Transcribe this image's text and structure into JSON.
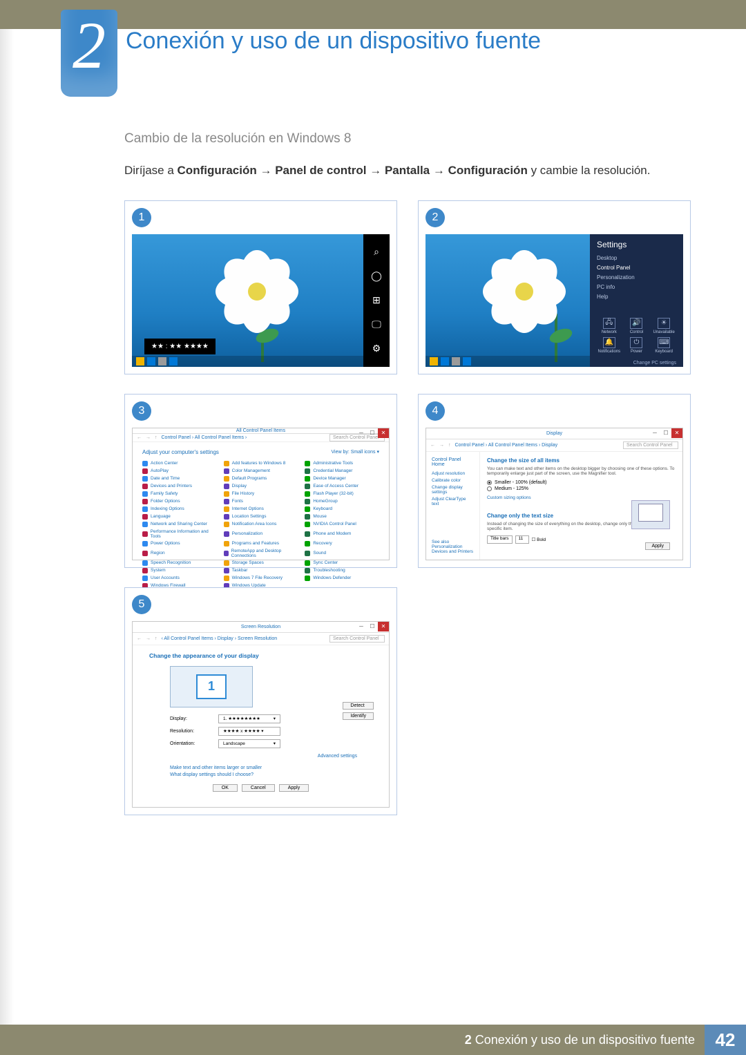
{
  "chapter": {
    "number": "2",
    "title": "Conexión y uso de un dispositivo fuente"
  },
  "section": {
    "subtitle": "Cambio de la resolución en Windows 8",
    "instruction_pre": "Diríjase a ",
    "path1": "Configuración",
    "path2": "Panel de control",
    "path3": "Pantalla",
    "path4": "Configuración",
    "instruction_post": " y cambie la resolución.",
    "arrow": "→"
  },
  "steps": [
    "1",
    "2",
    "3",
    "4",
    "5"
  ],
  "shot1": {
    "charms": {
      "search": "⌕",
      "share": "◯",
      "start": "⊞",
      "devices": "🖵",
      "settings": "⚙"
    },
    "clock": "★★ : ★★   ★★★★"
  },
  "shot2": {
    "settings_title": "Settings",
    "items": [
      "Desktop",
      "Control Panel",
      "Personalization",
      "PC info",
      "Help"
    ],
    "icons": [
      {
        "glyph": "🖧",
        "label": "Network"
      },
      {
        "glyph": "🔊",
        "label": "Control"
      },
      {
        "glyph": "☀",
        "label": "Unavailable"
      },
      {
        "glyph": "🔔",
        "label": "Notifications"
      },
      {
        "glyph": "⏻",
        "label": "Power"
      },
      {
        "glyph": "⌨",
        "label": "Keyboard"
      }
    ],
    "change": "Change PC settings"
  },
  "shot3": {
    "title": "All Control Panel Items",
    "crumb": "Control Panel  ›  All Control Panel Items  ›",
    "search_ph": "Search Control Panel",
    "heading": "Adjust your computer's settings",
    "viewby": "View by:   Small icons ▾",
    "links": [
      "Action Center",
      "Add features to Windows 8",
      "Administrative Tools",
      "AutoPlay",
      "Color Management",
      "Credential Manager",
      "Date and Time",
      "Default Programs",
      "Device Manager",
      "Devices and Printers",
      "Display",
      "Ease of Access Center",
      "Family Safety",
      "File History",
      "Flash Player (32-bit)",
      "Folder Options",
      "Fonts",
      "HomeGroup",
      "Indexing Options",
      "Internet Options",
      "Keyboard",
      "Language",
      "Location Settings",
      "Mouse",
      "Network and Sharing Center",
      "Notification Area Icons",
      "NVIDIA Control Panel",
      "Performance Information and Tools",
      "Personalization",
      "Phone and Modem",
      "Power Options",
      "Programs and Features",
      "Recovery",
      "Region",
      "RemoteApp and Desktop Connections",
      "Sound",
      "Speech Recognition",
      "Storage Spaces",
      "Sync Center",
      "System",
      "Taskbar",
      "Troubleshooting",
      "User Accounts",
      "Windows 7 File Recovery",
      "Windows Defender",
      "Windows Firewall",
      "Windows Update"
    ]
  },
  "shot4": {
    "title": "Display",
    "crumb": "Control Panel  ›  All Control Panel Items  ›  Display",
    "search_ph": "Search Control Panel",
    "side_head": "Control Panel Home",
    "side_links": [
      "Adjust resolution",
      "Calibrate color",
      "Change display settings",
      "Adjust ClearType text"
    ],
    "foot_head": "See also",
    "foot_links": [
      "Personalization",
      "Devices and Printers"
    ],
    "h1": "Change the size of all items",
    "desc": "You can make text and other items on the desktop bigger by choosing one of these options. To temporarily enlarge just part of the screen, use the Magnifier tool.",
    "r1": "Smaller - 100% (default)",
    "r2": "Medium - 125%",
    "custom": "Custom sizing options",
    "h2": "Change only the text size",
    "desc2": "Instead of changing the size of everything on the desktop, change only the text size for a specific item.",
    "dd1": "Title bars",
    "dd2": "11",
    "bold": "Bold",
    "apply": "Apply"
  },
  "shot5": {
    "title": "Screen Resolution",
    "crumb": "‹  All Control Panel Items  ›  Display  ›  Screen Resolution",
    "search_ph": "Search Control Panel",
    "h1": "Change the appearance of your display",
    "detect": "Detect",
    "identify": "Identify",
    "monitor_num": "1",
    "row_display": "Display:",
    "row_display_v": "1. ★★★★★★★★",
    "row_res": "Resolution:",
    "row_res_v": "★★★★ x ★★★★ ▾",
    "row_orient": "Orientation:",
    "row_orient_v": "Landscape",
    "adv": "Advanced settings",
    "help1": "Make text and other items larger or smaller",
    "help2": "What display settings should I choose?",
    "ok": "OK",
    "cancel": "Cancel",
    "apply": "Apply"
  },
  "footer": {
    "prefix": "2",
    "text": "Conexión y uso de un dispositivo fuente",
    "page": "42"
  }
}
